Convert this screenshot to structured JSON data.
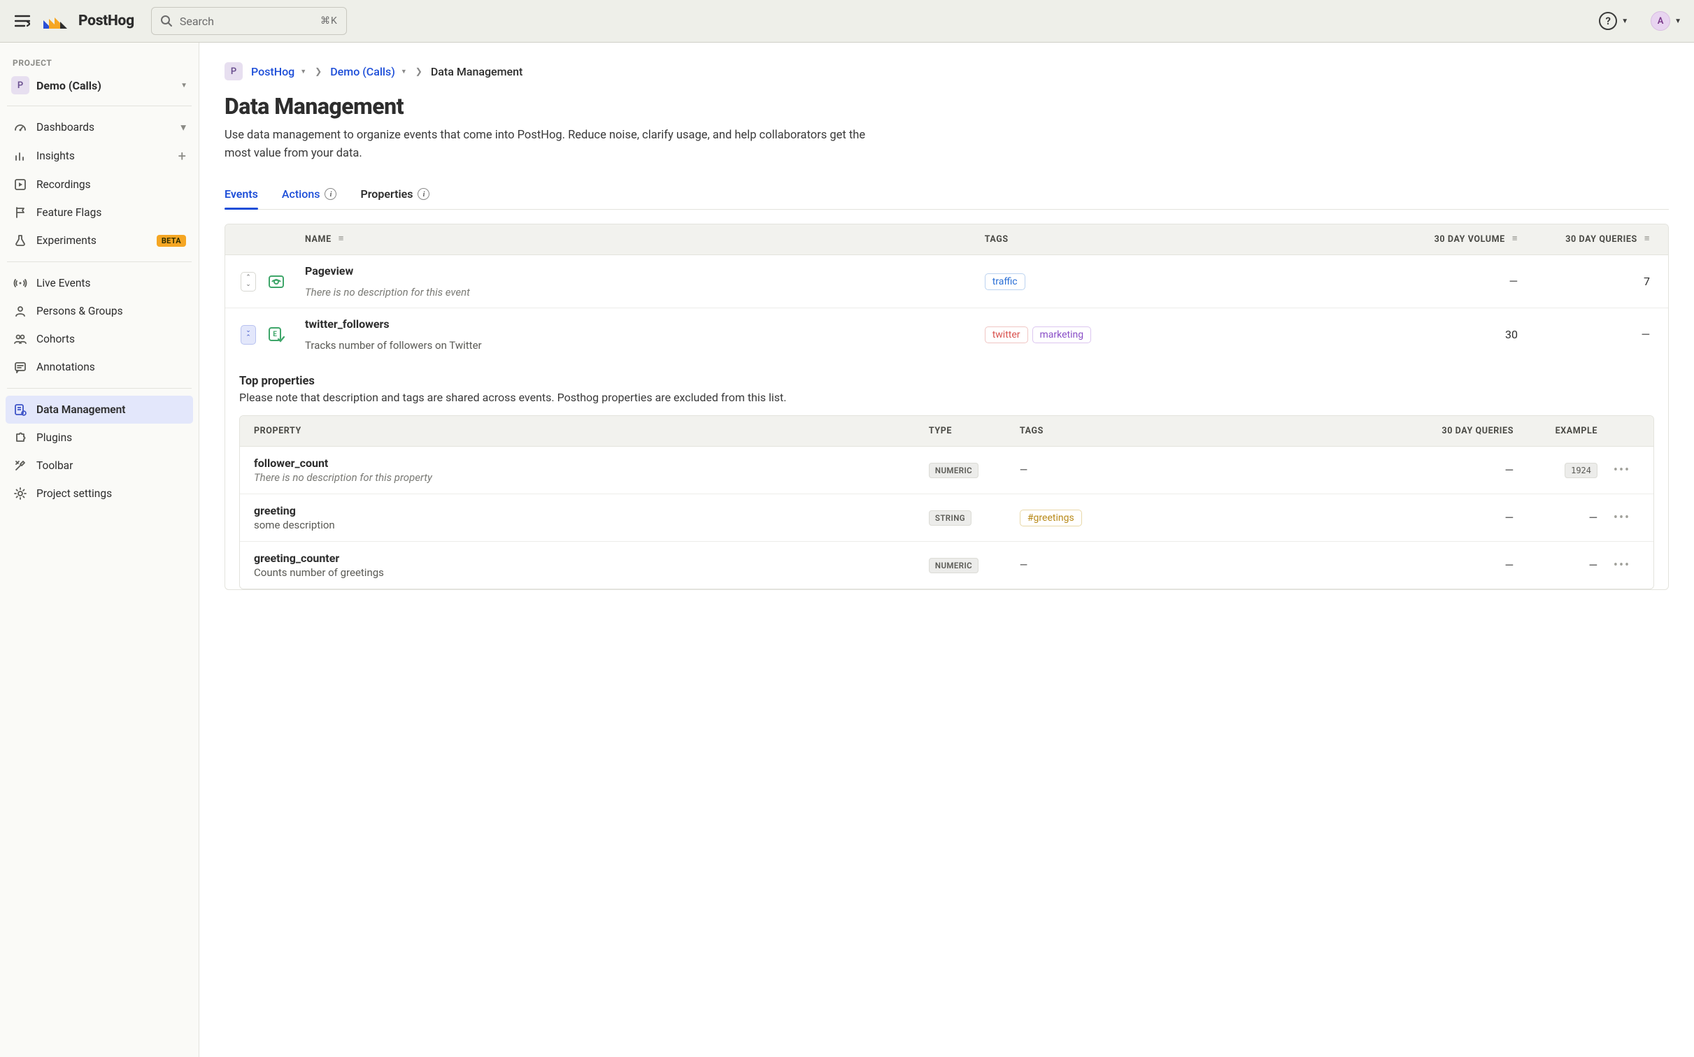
{
  "topbar": {
    "brand": "PostHog",
    "search_placeholder": "Search",
    "search_shortcut": "⌘K",
    "avatar_letter": "A"
  },
  "sidebar": {
    "section_label": "PROJECT",
    "project_badge": "P",
    "project_name": "Demo (Calls)",
    "items_a": [
      {
        "label": "Dashboards",
        "icon": "gauge",
        "trail": "caret"
      },
      {
        "label": "Insights",
        "icon": "bars",
        "trail": "plus"
      },
      {
        "label": "Recordings",
        "icon": "play"
      },
      {
        "label": "Feature Flags",
        "icon": "flag"
      },
      {
        "label": "Experiments",
        "icon": "flask",
        "badge": "BETA"
      }
    ],
    "items_b": [
      {
        "label": "Live Events",
        "icon": "signal"
      },
      {
        "label": "Persons & Groups",
        "icon": "person"
      },
      {
        "label": "Cohorts",
        "icon": "people"
      },
      {
        "label": "Annotations",
        "icon": "note"
      }
    ],
    "items_c": [
      {
        "label": "Data Management",
        "icon": "datamgmt",
        "active": true
      },
      {
        "label": "Plugins",
        "icon": "puzzle"
      },
      {
        "label": "Toolbar",
        "icon": "tools"
      },
      {
        "label": "Project settings",
        "icon": "gear"
      }
    ]
  },
  "breadcrumb": {
    "badge": "P",
    "org": "PostHog",
    "project": "Demo (Calls)",
    "current": "Data Management"
  },
  "page": {
    "title": "Data Management",
    "description": "Use data management to organize events that come into PostHog. Reduce noise, clarify usage, and help collaborators get the most value from your data."
  },
  "tabs": [
    {
      "label": "Events",
      "active": true
    },
    {
      "label": "Actions",
      "info": true,
      "link": true
    },
    {
      "label": "Properties",
      "info": true
    }
  ],
  "events_columns": {
    "name": "NAME",
    "tags": "TAGS",
    "volume": "30 DAY VOLUME",
    "queries": "30 DAY QUERIES"
  },
  "events": [
    {
      "name": "Pageview",
      "description": "There is no description for this event",
      "desc_italic": true,
      "icon": "eye",
      "tags": [
        {
          "text": "traffic",
          "cls": "tag-traffic"
        }
      ],
      "volume": "—",
      "queries": "7",
      "expanded": false
    },
    {
      "name": "twitter_followers",
      "description": "Tracks number of followers on Twitter",
      "desc_italic": false,
      "icon": "eventcheck",
      "tags": [
        {
          "text": "twitter",
          "cls": "tag-twitter"
        },
        {
          "text": "marketing",
          "cls": "tag-marketing"
        }
      ],
      "volume": "30",
      "queries": "—",
      "expanded": true
    }
  ],
  "expanded_detail": {
    "title": "Top properties",
    "note": "Please note that description and tags are shared across events. Posthog properties are excluded from this list.",
    "columns": {
      "property": "PROPERTY",
      "type": "TYPE",
      "tags": "TAGS",
      "queries": "30 DAY QUERIES",
      "example": "EXAMPLE"
    },
    "rows": [
      {
        "name": "follower_count",
        "description": "There is no description for this property",
        "desc_italic": true,
        "type": "NUMERIC",
        "tags": [],
        "tags_dash": true,
        "queries": "—",
        "example": "1924"
      },
      {
        "name": "greeting",
        "description": "some description",
        "desc_italic": false,
        "type": "STRING",
        "tags": [
          {
            "text": "#greetings",
            "cls": "tag-greetings"
          }
        ],
        "queries": "—",
        "example": "—"
      },
      {
        "name": "greeting_counter",
        "description": "Counts number of greetings",
        "desc_italic": false,
        "type": "NUMERIC",
        "tags": [],
        "tags_dash": true,
        "queries": "—",
        "example": "—"
      }
    ]
  }
}
